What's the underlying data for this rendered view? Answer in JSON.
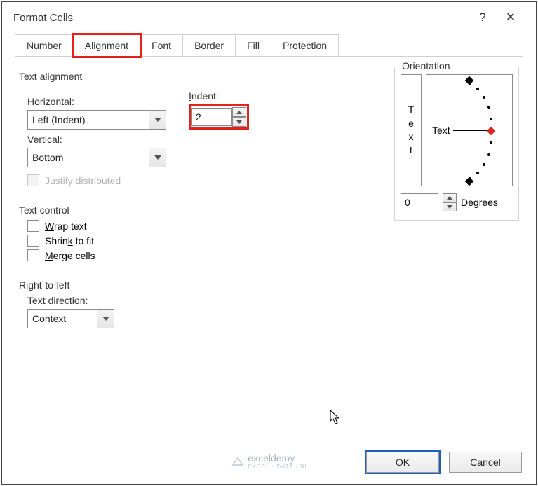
{
  "titlebar": {
    "title": "Format Cells"
  },
  "tabs": [
    "Number",
    "Alignment",
    "Font",
    "Border",
    "Fill",
    "Protection"
  ],
  "text_alignment": {
    "group_label": "Text alignment",
    "horizontal_label": "Horizontal:",
    "horizontal_value": "Left (Indent)",
    "indent_label": "Indent:",
    "indent_value": "2",
    "vertical_label": "Vertical:",
    "vertical_value": "Bottom",
    "justify_label": "Justify distributed"
  },
  "text_control": {
    "group_label": "Text control",
    "wrap": "Wrap text",
    "shrink": "Shrink to fit",
    "merge": "Merge cells"
  },
  "rtl": {
    "group_label": "Right-to-left",
    "dir_label": "Text direction:",
    "dir_value": "Context"
  },
  "orientation": {
    "group_label": "Orientation",
    "vertical_text": [
      "T",
      "e",
      "x",
      "t"
    ],
    "horizontal_text": "Text",
    "degrees_value": "0",
    "degrees_label": "Degrees"
  },
  "footer": {
    "ok": "OK",
    "cancel": "Cancel"
  },
  "watermark": {
    "brand": "exceldemy",
    "sub": "EXCEL · DATA · BI"
  }
}
